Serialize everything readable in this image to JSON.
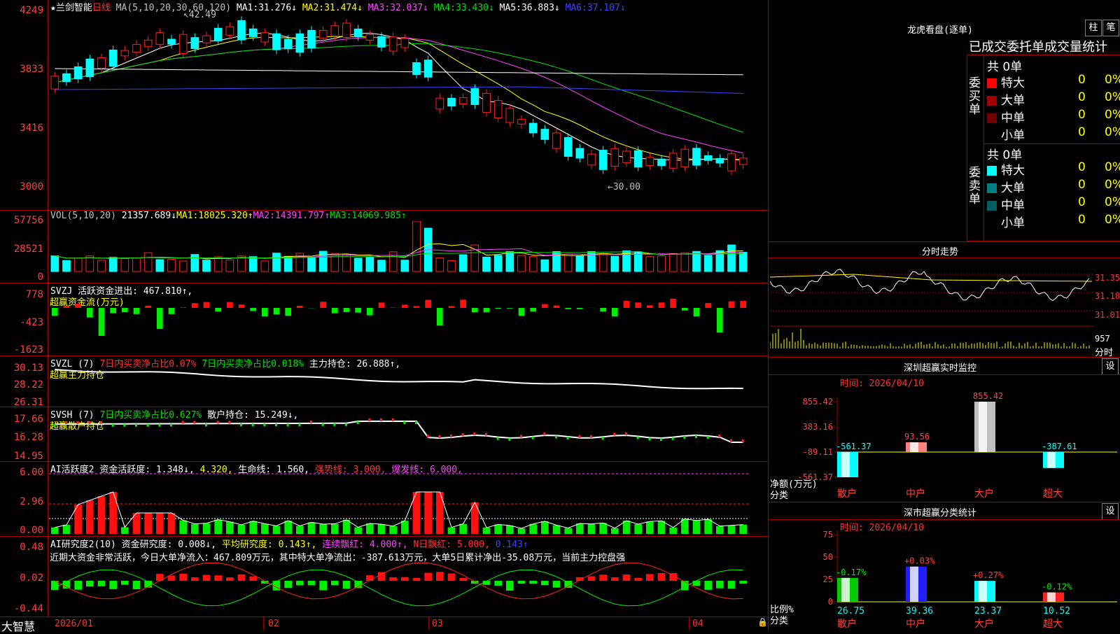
{
  "main_chart": {
    "title": "★兰剑智能",
    "period": "日线",
    "ma_params": "MA(5,10,20,30,60,120)",
    "ma": [
      {
        "label": "MA1:",
        "value": "31.276↓",
        "color": "#ffffff"
      },
      {
        "label": "MA2:",
        "value": "31.474↓",
        "color": "#ffff00"
      },
      {
        "label": "MA3:",
        "value": "32.037↓",
        "color": "#ff40ff"
      },
      {
        "label": "MA4:",
        "value": "33.430↓",
        "color": "#00e000"
      },
      {
        "label": "MA5:",
        "value": "36.883↓",
        "color": "#ffffff"
      },
      {
        "label": "MA6:",
        "value": "37.107↓",
        "color": "#4040ff"
      }
    ],
    "y_ticks": [
      "4249",
      "3833",
      "3416",
      "3000"
    ],
    "high_marker": "42.49",
    "low_marker": "30.00"
  },
  "vol_panel": {
    "header": "VOL(5,10,20)",
    "value": "21357.689↓",
    "ma": [
      {
        "label": "MA1:",
        "value": "18025.320↑",
        "color": "#ffff00"
      },
      {
        "label": "MA2:",
        "value": "14391.797↑",
        "color": "#ff40ff"
      },
      {
        "label": "MA3:",
        "value": "14069.985↑",
        "color": "#00e000"
      }
    ],
    "y_ticks": [
      "57756",
      "28521",
      "0"
    ]
  },
  "svzj_panel": {
    "header": "SVZJ  活跃资金进出:",
    "value": "467.810↑,",
    "sub": "超赢资金流(万元)",
    "y_ticks": [
      "778",
      "-423",
      "-1623"
    ]
  },
  "svzl_panel": {
    "header": "SVZL (7)",
    "t1": "7日内买卖净占比0.07%",
    "t2": "7日内买卖净占比0.018%",
    "t3": "主力持仓:",
    "t3v": "26.888↑,",
    "sub": "超赢主力持仓",
    "y_ticks": [
      "30.13",
      "28.22",
      "26.31"
    ]
  },
  "svsh_panel": {
    "header": "SVSH (7)",
    "t1": "7日内买卖净占比0.627%",
    "t2": "散户持仓:",
    "t2v": "15.249↓,",
    "sub": "超赢散户持仓",
    "y_ticks": [
      "17.66",
      "16.28",
      "14.95"
    ]
  },
  "ai_active_panel": {
    "header": "AI活跃度2",
    "a": "资金活跃度:",
    "av": "1.348↓,",
    "bv": "4.320,",
    "c": "生命线:",
    "cv": "1.560,",
    "d": "强势线:",
    "dv": "3.000,",
    "e": "爆发线:",
    "ev": "6.000,",
    "y_ticks": [
      "6.00",
      "2.96",
      "0.00"
    ]
  },
  "ai_research_panel": {
    "header": "AI研究度2(10)",
    "a": "资金研究度:",
    "av": "0.008↓,",
    "b": "平均研究度:",
    "bv": "0.143↑,",
    "c": "连续飘红:",
    "cv": "4.000↑,",
    "d": "N日飘红:",
    "dv": "5.000,",
    "ev": "0.143↑",
    "summary": "近期大资金非常活跃，今日大单净流入：467.809万元，其中特大单净流出：-387.613万元，大单5日累计净出-35.08万元，当前主力控盘强",
    "y_ticks": [
      "0.48",
      "0.02",
      "-0.44"
    ]
  },
  "x_axis": {
    "brand": "大智慧",
    "labels": [
      "2026/01",
      "02",
      "03",
      "04"
    ]
  },
  "dragon_tiger": {
    "title": "龙虎看盘(逐单)",
    "btn_bar": "柱",
    "btn_pen": "笔",
    "tabs": "已成交委托单成交量统计",
    "buy_label": "委买单",
    "sell_label": "委卖单",
    "buy_total": "共 0单",
    "sell_total": "共 0单",
    "buy_rows": [
      {
        "name": "特大",
        "count": "0",
        "pct": "0%",
        "color": "#ff0000"
      },
      {
        "name": "大单",
        "count": "0",
        "pct": "0%",
        "color": "#a00000"
      },
      {
        "name": "中单",
        "count": "0",
        "pct": "0%",
        "color": "#700000"
      },
      {
        "name": "小单",
        "count": "0",
        "pct": "0%",
        "color": "#000000"
      }
    ],
    "sell_rows": [
      {
        "name": "特大",
        "count": "0",
        "pct": "0%",
        "color": "#00ffff"
      },
      {
        "name": "大单",
        "count": "0",
        "pct": "0%",
        "color": "#008080"
      },
      {
        "name": "中单",
        "count": "0",
        "pct": "0%",
        "color": "#006060"
      },
      {
        "name": "小单",
        "count": "0",
        "pct": "0%",
        "color": "#000000"
      }
    ]
  },
  "intraday": {
    "title": "分时走势",
    "prices": [
      "31.35",
      "31.18",
      "31.01"
    ],
    "vol_label": "957",
    "vol_unit": "分时"
  },
  "sz_monitor": {
    "title": "深圳超赢实时监控",
    "btn": "设",
    "time": "时间: 2026/04/10",
    "y_ticks": [
      "855.42",
      "383.16",
      "-89.11",
      "-561.37"
    ],
    "ylabel": "净额(万元)",
    "xlabel": "分类",
    "categories": [
      "散户",
      "中户",
      "大户",
      "超大"
    ],
    "values": [
      -561.37,
      93.56,
      855.42,
      -387.61
    ],
    "value_labels": [
      "-561.37",
      "93.56",
      "855.42",
      "-387.61"
    ]
  },
  "sz_classify": {
    "title": "深市超赢分类统计",
    "btn": "设",
    "time": "时间: 2026/04/10",
    "y_ticks": [
      "75",
      "50",
      "25",
      "0"
    ],
    "ylabel": "比例%",
    "xlabel": "分类",
    "categories": [
      "散户",
      "中户",
      "大户",
      "超大"
    ],
    "values": [
      26.75,
      39.36,
      23.37,
      10.52
    ],
    "deltas": [
      "-0.17%",
      "+0.03%",
      "+0.27%",
      "-0.12%"
    ],
    "value_labels": [
      "26.75",
      "39.36",
      "23.37",
      "10.52"
    ]
  },
  "chart_data": [
    {
      "type": "bar",
      "title": "深圳超赢实时监控",
      "ylabel": "净额(万元)",
      "xlabel": "分类",
      "categories": [
        "散户",
        "中户",
        "大户",
        "超大"
      ],
      "values": [
        -561.37,
        93.56,
        855.42,
        -387.61
      ],
      "ylim": [
        -561.37,
        855.42
      ]
    },
    {
      "type": "bar",
      "title": "深市超赢分类统计",
      "ylabel": "比例%",
      "xlabel": "分类",
      "categories": [
        "散户",
        "中户",
        "大户",
        "超大"
      ],
      "values": [
        26.75,
        39.36,
        23.37,
        10.52
      ],
      "ylim": [
        0,
        75
      ]
    }
  ]
}
